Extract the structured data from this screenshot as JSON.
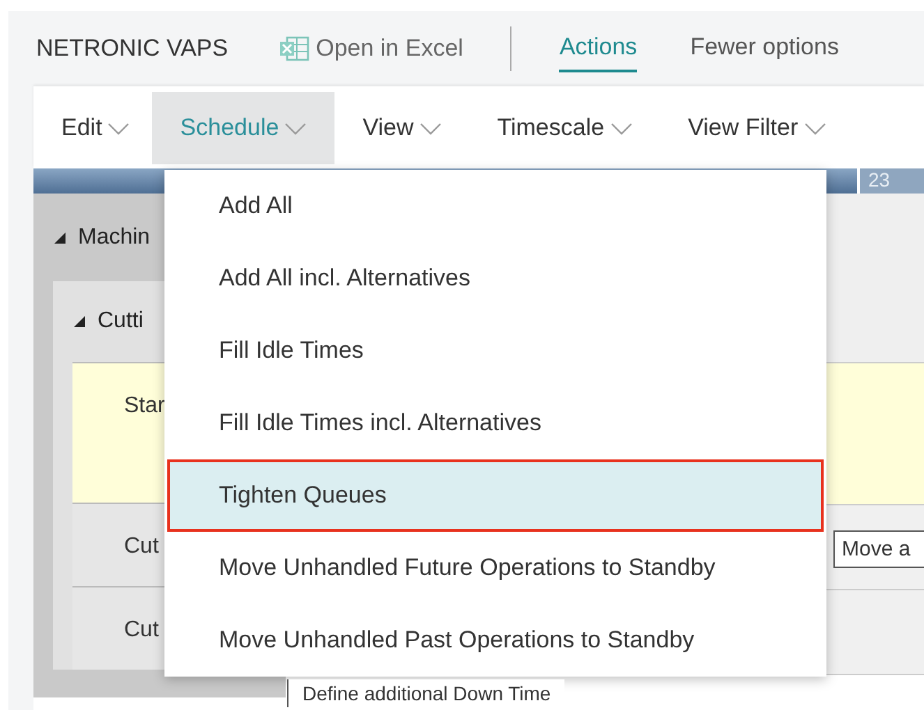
{
  "header": {
    "app_title": "NETRONIC VAPS",
    "excel_button": "Open in Excel",
    "tabs": [
      {
        "label": "Actions",
        "selected": true
      },
      {
        "label": "Fewer options",
        "selected": false
      }
    ]
  },
  "menu_bar": [
    {
      "label": "Edit",
      "selected": false
    },
    {
      "label": "Schedule",
      "selected": true
    },
    {
      "label": "View",
      "selected": false
    },
    {
      "label": "Timescale",
      "selected": false
    },
    {
      "label": "View Filter",
      "selected": false
    }
  ],
  "gantt": {
    "timescale_label": "23",
    "group_row": "Machin",
    "subgroup_row": "Cutti",
    "rows": [
      {
        "label": "Star",
        "highlighted": true
      },
      {
        "label": "Cut",
        "highlighted": false
      },
      {
        "label": "Cut",
        "highlighted": false
      }
    ],
    "tooltip": "Move a",
    "bottom_tooltip": "Define additional Down Time"
  },
  "dropdown": [
    {
      "label": "Add All",
      "selected": false
    },
    {
      "label": "Add All incl. Alternatives",
      "selected": false
    },
    {
      "label": "Fill Idle Times",
      "selected": false
    },
    {
      "label": "Fill Idle Times incl. Alternatives",
      "selected": false
    },
    {
      "label": "Tighten Queues",
      "selected": true
    },
    {
      "label": "Move Unhandled Future Operations to Standby",
      "selected": false
    },
    {
      "label": "Move Unhandled Past Operations to Standby",
      "selected": false
    }
  ]
}
